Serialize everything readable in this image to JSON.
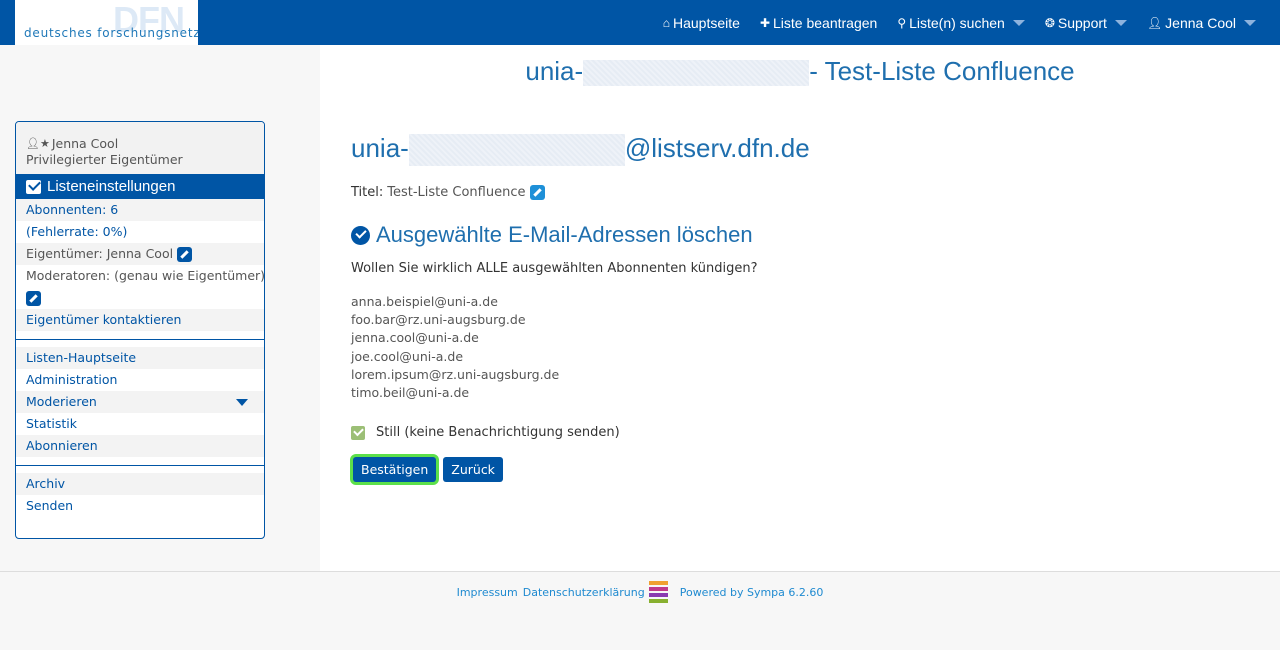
{
  "logo": {
    "mark": "DFN",
    "text": "deutsches forschungsnetz"
  },
  "nav": {
    "home": "Hauptseite",
    "request_list": "Liste beantragen",
    "search_lists": "Liste(n) suchen",
    "support": "Support",
    "user": "Jenna Cool"
  },
  "sidebar": {
    "user_name": "Jenna Cool",
    "user_role": "Privilegierter Eigentümer",
    "settings_header": "Listeneinstellungen",
    "subscribers": "Abonnenten: 6",
    "error_rate": "(Fehlerrate: 0%)",
    "owner": "Eigentümer: Jenna Cool",
    "moderators": "Moderatoren: (genau wie Eigentümer)",
    "contact_owners": "Eigentümer kontaktieren",
    "links1": [
      "Listen-Hauptseite",
      "Administration",
      "Moderieren",
      "Statistik",
      "Abonnieren"
    ],
    "links2": [
      "Archiv",
      "Senden"
    ]
  },
  "main": {
    "title_prefix": "unia-",
    "title_suffix": "- Test-Liste Confluence",
    "address_prefix": "unia-",
    "address_suffix": "@listserv.dfn.de",
    "title_label": "Titel:",
    "title_value": "Test-Liste Confluence",
    "section_heading": "Ausgewählte E-Mail-Adressen löschen",
    "question": "Wollen Sie wirklich ALLE ausgewählten Abonnenten kündigen?",
    "emails": [
      "anna.beispiel@uni-a.de",
      "foo.bar@rz.uni-augsburg.de",
      "jenna.cool@uni-a.de",
      "joe.cool@uni-a.de",
      "lorem.ipsum@rz.uni-augsburg.de",
      "timo.beil@uni-a.de"
    ],
    "quiet_label": "Still (keine Benachrichtigung senden)",
    "confirm_button": "Bestätigen",
    "back_button": "Zurück"
  },
  "footer": {
    "impressum": "Impressum",
    "privacy": "Datenschutzerklärung",
    "powered": "Powered by Sympa 6.2.60"
  },
  "colors": {
    "primary": "#0055a5",
    "link": "#1f6fae",
    "focus": "#5ce04a",
    "checkbox": "#9cbf76"
  }
}
